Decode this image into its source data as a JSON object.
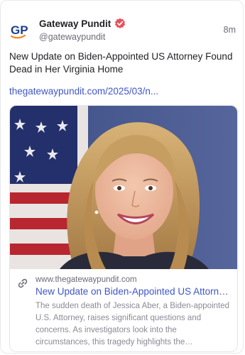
{
  "author": {
    "name": "Gateway Pundit",
    "handle": "@gatewaypundit",
    "avatar_text": "GP",
    "verified_icon": "verified-badge-icon"
  },
  "post": {
    "timestamp": "8m",
    "text": "New Update on Biden-Appointed US Attorney Found Dead in Her Virginia Home",
    "link_text": "thegatewaypundit.com/2025/03/n..."
  },
  "link_card": {
    "image_alt": "Portrait of a smiling woman with long blonde hair in front of an American flag",
    "link_icon": "link-icon",
    "domain": "www.thegatewaypundit.com",
    "title": "New Update on Biden-Appointed US Attorney ...",
    "description": "The sudden death of Jessica Aber, a Biden-appointed U.S. Attorney, raises significant questions and concerns. As investigators look into the circumstances, this tragedy highlights the complexities surrounding h..."
  },
  "colors": {
    "link": "#3f56c9",
    "verified": "#e8505b",
    "brand_blue": "#1d3f8f",
    "brand_orange": "#f08a22"
  }
}
